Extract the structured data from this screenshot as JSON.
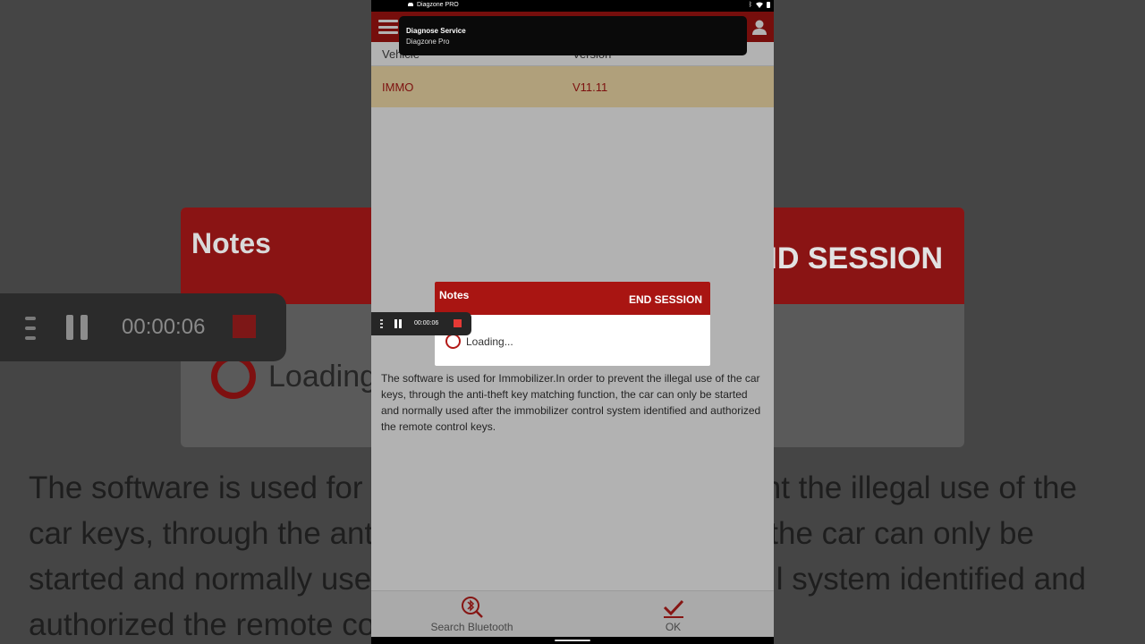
{
  "status_bar": {
    "app_name": "Diagzone PRO"
  },
  "notification": {
    "title": "Diagnose Service",
    "subtitle": "Diagzone Pro"
  },
  "table": {
    "columns": [
      "Vehicle",
      "Version"
    ],
    "selected_row": {
      "vehicle": "IMMO",
      "version": "V11.11"
    }
  },
  "description": "The software is used for Immobilizer.In order to prevent the illegal use of the car keys, through the anti-theft key matching function, the car can only be started and normally used after the immobilizer control system identified and authorized the remote control keys.",
  "dialog": {
    "title": "Notes",
    "end_button": "END SESSION",
    "loading_text": "Loading..."
  },
  "recorder": {
    "time": "00:00:06"
  },
  "bottom_bar": {
    "search_bluetooth": "Search Bluetooth",
    "ok": "OK"
  },
  "background_zoom": {
    "notes_title": "Notes",
    "end_fragment": "ND SESSION",
    "loading_fragment": "Loading",
    "recorder_time": "00:00:06",
    "paragraph_lines": [
      "The software is used for",
      "car keys, through the anti",
      "started and normally use",
      "authorized the remote co"
    ],
    "paragraph_lines_right": [
      "nt the illegal use of the",
      "the car can only be",
      "l system identified and"
    ]
  },
  "colors": {
    "brand_red": "#a91512",
    "selected_row_bg": "#fde5b0",
    "selected_row_text": "#b31a17"
  }
}
